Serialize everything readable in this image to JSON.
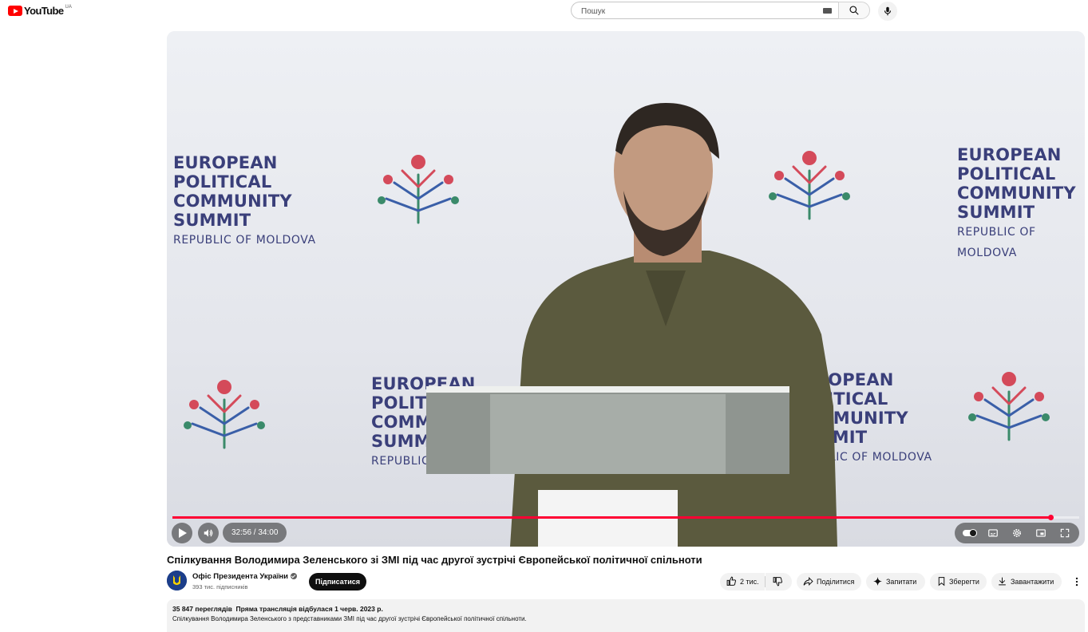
{
  "masthead": {
    "logo_text": "YouTube",
    "logo_region": "UA",
    "search_placeholder": "Пошук"
  },
  "player": {
    "time_display": "32:56 / 34:00",
    "progress_fraction": 0.9686,
    "banner": {
      "line1": "EUROPEAN",
      "line2": "POLITICAL",
      "line3": "COMMUNITY",
      "line4": "SUMMIT",
      "subline": "REPUBLIC OF MOLDOVA"
    },
    "accent_color": "#ff0033"
  },
  "video": {
    "title": "Спілкування Володимира Зеленського зі ЗМІ під час другої зустрічі Європейської політичної спільноти"
  },
  "channel": {
    "name": "Офіс Президента України",
    "subscribers": "393 тис. підписників",
    "subscribe_label": "Підписатися"
  },
  "actions": {
    "likes": "2 тис.",
    "share": "Поділитися",
    "ask": "Запитати",
    "save": "Зберегти",
    "download": "Завантажити"
  },
  "description": {
    "views": "35 847 переглядів",
    "stream_info": "Пряма трансляція відбулася 1 черв. 2023 р.",
    "text": "Спілкування Володимира Зеленського з представниками ЗМІ під час другої зустрічі Європейської політичної спільноти."
  }
}
